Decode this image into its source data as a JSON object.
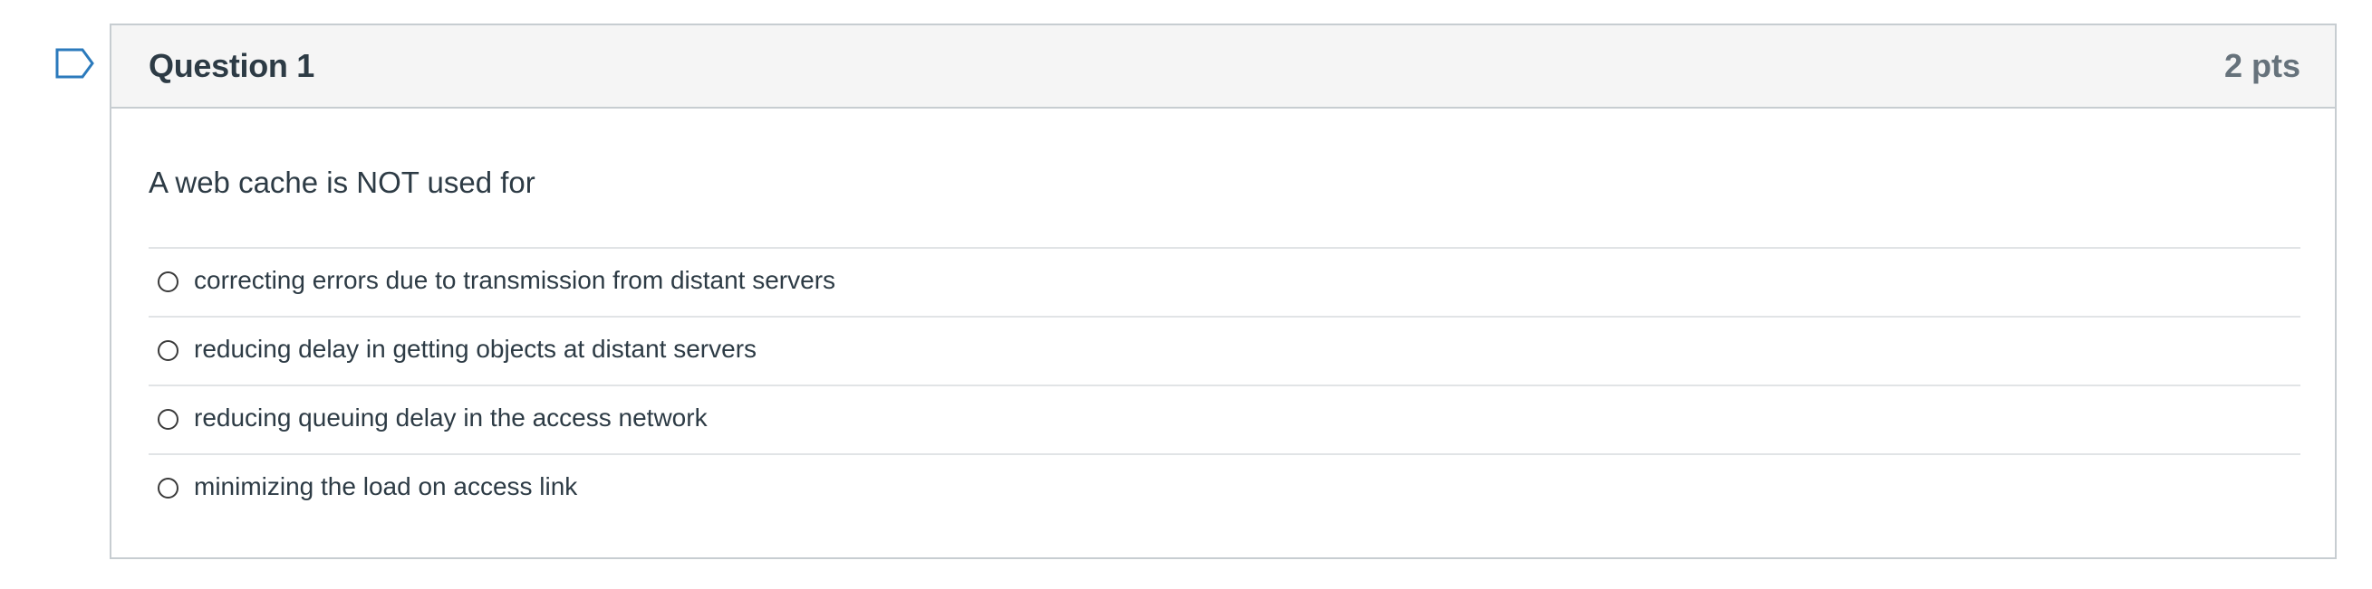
{
  "question": {
    "title": "Question 1",
    "points": "2 pts",
    "text": "A web cache is NOT used for",
    "flag_icon": "flag-question-icon"
  },
  "answers": [
    {
      "label": "correcting errors due to transmission from distant servers",
      "selected": false
    },
    {
      "label": "reducing delay in getting objects at distant servers",
      "selected": false
    },
    {
      "label": "reducing queuing delay in the access network",
      "selected": false
    },
    {
      "label": "minimizing the load on access link",
      "selected": false
    }
  ],
  "colors": {
    "header_bg": "#f5f5f5",
    "border": "#c7cdd1",
    "text": "#2d3b45",
    "points_text": "#66727b",
    "flag_stroke": "#2b7abc"
  }
}
